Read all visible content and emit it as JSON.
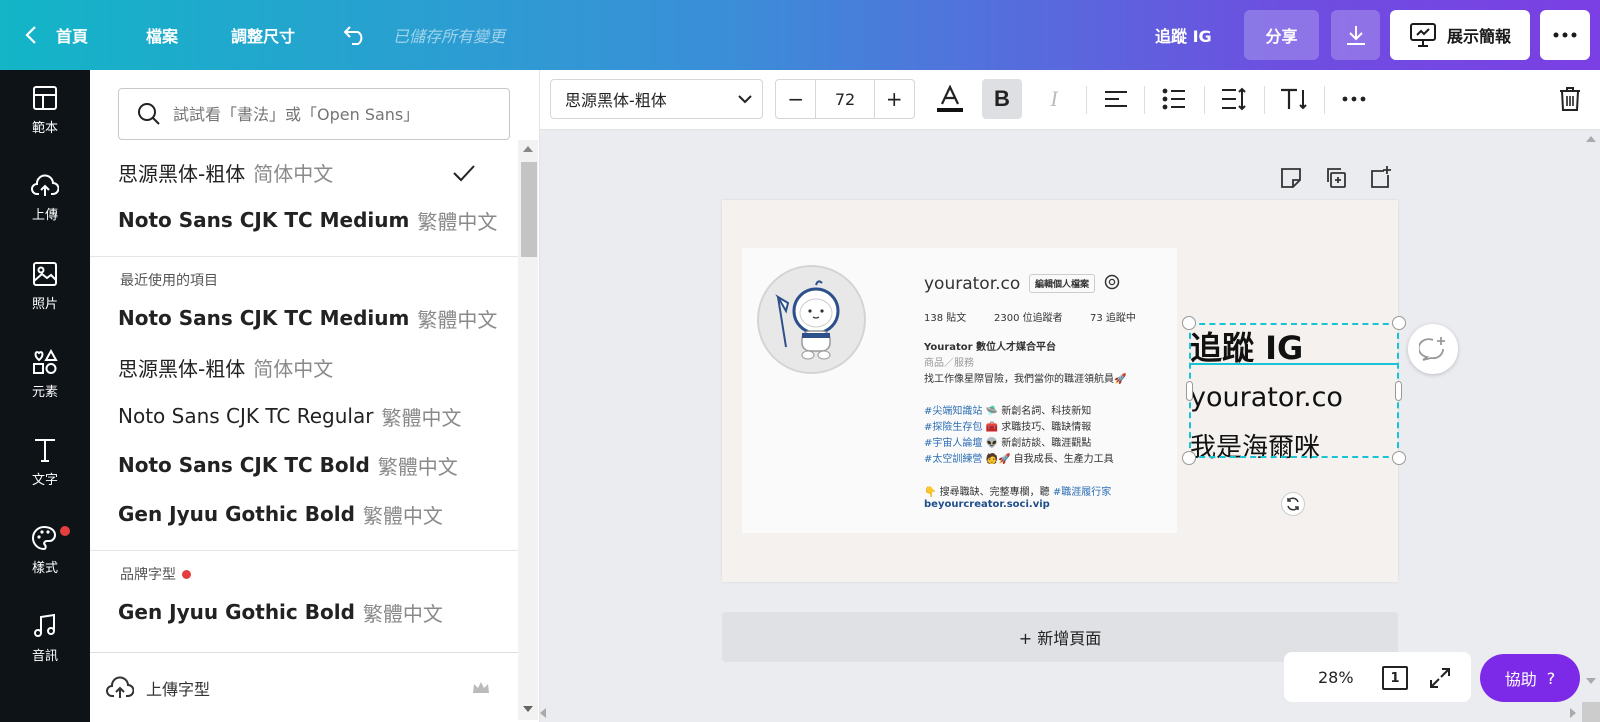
{
  "topbar": {
    "home": "首頁",
    "file": "檔案",
    "resize": "調整尺寸",
    "saved_status": "已儲存所有變更",
    "doc_title": "追蹤 IG",
    "share": "分享",
    "present": "展示簡報"
  },
  "nav": {
    "items": [
      {
        "label": "範本",
        "icon": "template-icon"
      },
      {
        "label": "上傳",
        "icon": "upload-cloud-icon"
      },
      {
        "label": "照片",
        "icon": "photo-icon"
      },
      {
        "label": "元素",
        "icon": "elements-icon"
      },
      {
        "label": "文字",
        "icon": "text-icon"
      },
      {
        "label": "樣式",
        "icon": "palette-icon"
      },
      {
        "label": "音訊",
        "icon": "music-icon"
      }
    ],
    "badge_color": "#e53e3e"
  },
  "font_panel": {
    "search_placeholder": "試試看「書法」或「Open Sans」",
    "top_fonts": [
      {
        "name": "思源黑体-粗体",
        "lang": "简体中文",
        "selected": true
      },
      {
        "name": "Noto Sans CJK TC Medium",
        "lang": "繁體中文",
        "selected": false
      }
    ],
    "recent_heading": "最近使用的項目",
    "recent_fonts": [
      {
        "name": "Noto Sans CJK TC Medium",
        "lang": "繁體中文"
      },
      {
        "name": "思源黑体-粗体",
        "lang": "简体中文"
      },
      {
        "name": "Noto Sans CJK TC Regular",
        "lang": "繁體中文"
      },
      {
        "name": "Noto Sans CJK TC Bold",
        "lang": "繁體中文"
      },
      {
        "name": "Gen Jyuu Gothic Bold",
        "lang": "繁體中文"
      }
    ],
    "brand_heading": "品牌字型",
    "brand_fonts": [
      {
        "name": "Gen Jyuu Gothic Bold",
        "lang": "繁體中文"
      }
    ],
    "upload_font": "上傳字型"
  },
  "toolbar": {
    "font_name": "思源黑体-粗体",
    "font_size": "72",
    "minus": "−",
    "plus": "+"
  },
  "canvas": {
    "profile": {
      "username": "yourator.co",
      "edit_profile": "編輯個人檔案",
      "posts": "138 貼文",
      "followers": "2300 位追蹤者",
      "following": "73 追蹤中",
      "bio_name": "Yourator 數位人才媒合平台",
      "category": "商品／服務",
      "bio_line": "找工作像星際冒險，我們當你的職涯領航員🚀",
      "hashtags": [
        {
          "tag": "#尖端知識站",
          "text": "🛸 新創名詞、科技新知"
        },
        {
          "tag": "#探險生存包",
          "text": "🧰 求職技巧、職缺情報"
        },
        {
          "tag": "#宇宙人論壇",
          "text": "👽 新創訪談、職涯觀點"
        },
        {
          "tag": "#太空訓練營",
          "text": "🧑🚀 自我成長、生產力工具"
        }
      ],
      "cta_prefix": "👇 搜尋職缺、完整專欄，聽 ",
      "cta_tag": "#職涯履行家",
      "link": "beyourcreator.soci.vip"
    },
    "title_text": "追蹤 IG",
    "handle_text": "yourator.co",
    "subtitle_text": "我是海爾咪",
    "add_page": "+ 新增頁面"
  },
  "footer": {
    "zoom": "28%",
    "page_num": "1",
    "help": "協助",
    "help_mark": "?"
  },
  "colors": {
    "accent": "#7d2ae8",
    "selection": "#18c3d6",
    "tag_blue": "#2d6fb5"
  }
}
